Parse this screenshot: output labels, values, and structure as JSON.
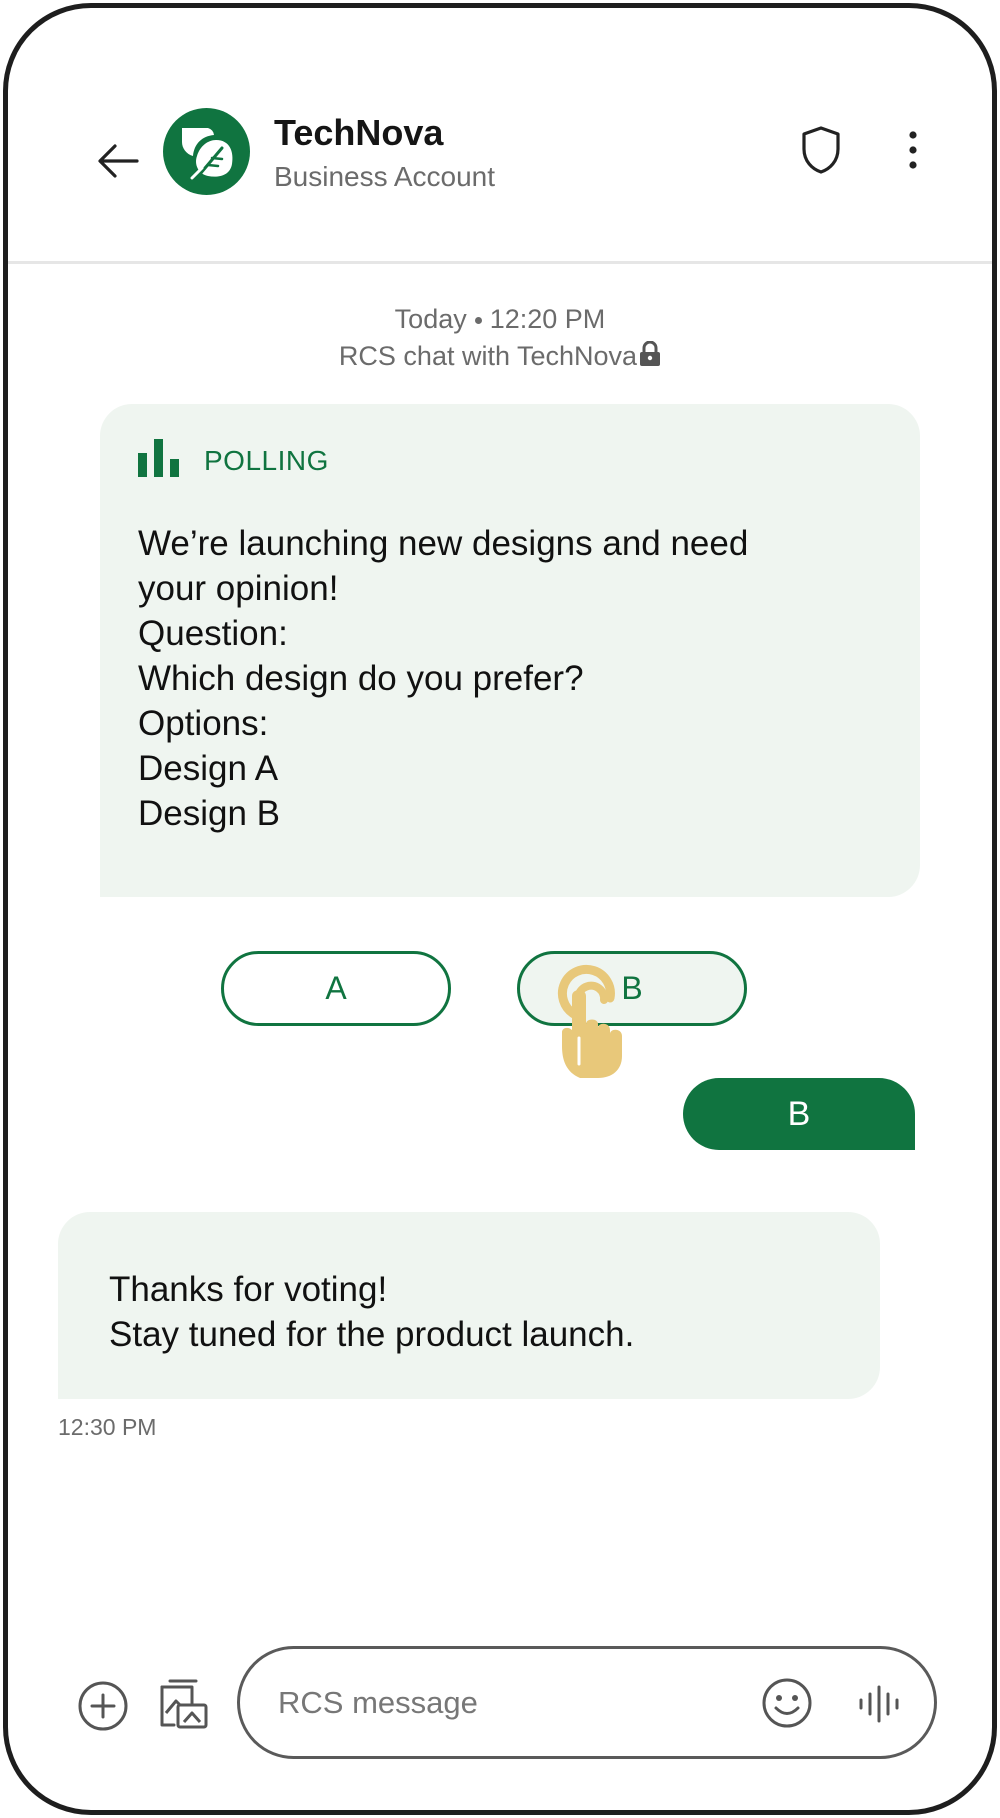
{
  "header": {
    "back_icon": "arrow-left",
    "contact_name": "TechNova",
    "contact_subtitle": "Business Account",
    "avatar_icon": "leaf",
    "shield_icon": "shield",
    "menu_icon": "more-vertical",
    "brand_color": "#107440"
  },
  "meta": {
    "day": "Today",
    "time": "12:20 PM",
    "chat_label": "RCS chat with TechNova",
    "lock_icon": "lock"
  },
  "poll": {
    "tag_icon": "bar-chart",
    "tag_label": "POLLING",
    "lines": [
      "We’re launching new designs and need",
      "your opinion!",
      "Question:",
      "Which design do you prefer?",
      "Options:",
      "Design A",
      "Design B"
    ],
    "options": [
      "A",
      "B"
    ],
    "tap_icon": "hand-tap"
  },
  "sent_message": "B",
  "reply": {
    "lines": [
      "Thanks for voting!",
      "Stay tuned for the product launch."
    ],
    "time": "12:30 PM"
  },
  "composer": {
    "add_icon": "plus-circle",
    "gallery_icon": "image",
    "placeholder": "RCS message",
    "emoji_icon": "smiley",
    "voice_icon": "waveform"
  }
}
